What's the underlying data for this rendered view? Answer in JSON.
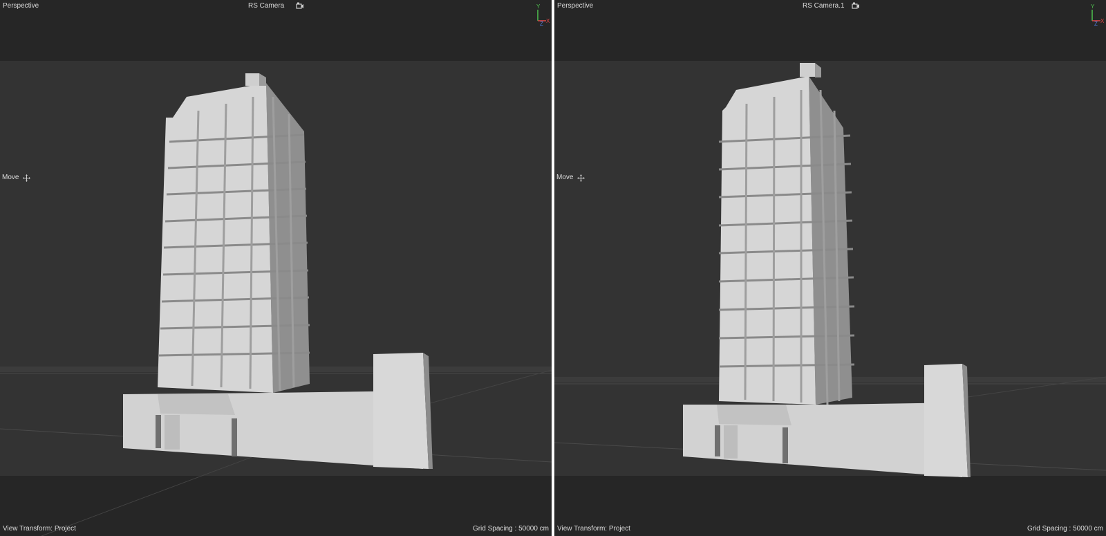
{
  "viewports": [
    {
      "view_name": "Perspective",
      "camera_name": "RS Camera",
      "tool_label": "Move",
      "view_transform": "View Transform: Project",
      "grid_spacing": "Grid Spacing : 50000 cm"
    },
    {
      "view_name": "Perspective",
      "camera_name": "RS Camera.1",
      "tool_label": "Move",
      "view_transform": "View Transform: Project",
      "grid_spacing": "Grid Spacing : 50000 cm"
    }
  ],
  "axis_labels": {
    "x": "X",
    "y": "Y",
    "z": "Z"
  },
  "colors": {
    "viewport_bg": "#262626",
    "safe_frame_bg": "#333333",
    "model_light": "#d6d6d6",
    "model_mid": "#bcbcbc",
    "model_dark": "#8f8f8f",
    "axis_x": "#e04848",
    "axis_y": "#4fc24f",
    "axis_z": "#4c7be0",
    "divider": "#ffffff"
  },
  "icons": [
    "camera-icon",
    "move-icon",
    "axis-gizmo-icon"
  ]
}
